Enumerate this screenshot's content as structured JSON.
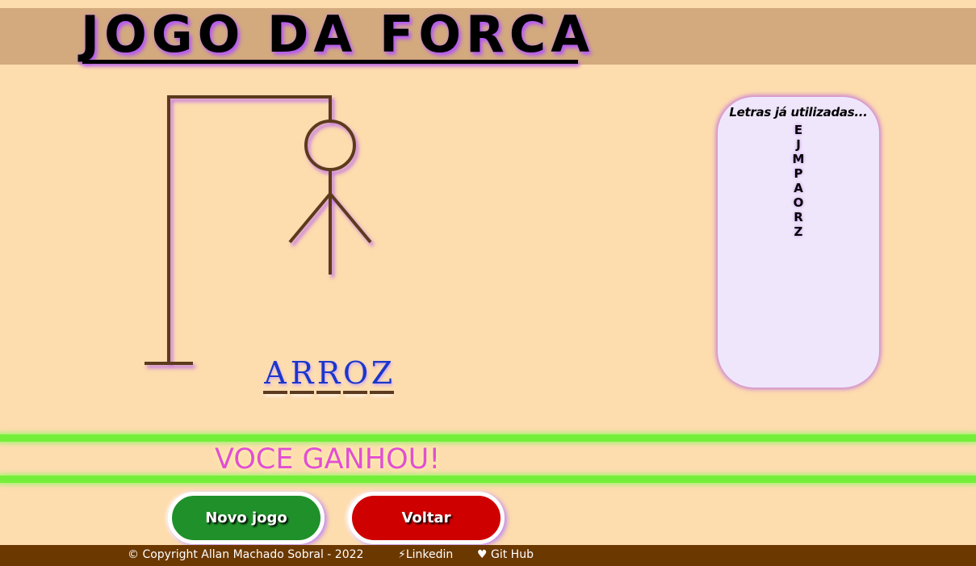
{
  "header": {
    "title": "JOGO DA FORCA"
  },
  "word": {
    "letters": [
      "A",
      "R",
      "R",
      "O",
      "Z"
    ]
  },
  "letters_panel": {
    "title": "Letras já utilizadas...",
    "used": [
      "E",
      "J",
      "M",
      "P",
      "A",
      "O",
      "R",
      "Z"
    ]
  },
  "result": {
    "message": "VOCE GANHOU!"
  },
  "buttons": {
    "new_game": "Novo jogo",
    "back": "Voltar"
  },
  "footer": {
    "copyright": "© Copyright Allan Machado Sobral - 2022",
    "linkedin": "⚡Linkedin",
    "github": "♥ Git Hub"
  },
  "colors": {
    "background": "#fddcae",
    "header_band": "#d2aa7d",
    "gallows": "#5c3a1e",
    "word_letters": "#1b37c9",
    "result_text": "#e24fd3",
    "new_game_button": "#20902a",
    "back_button": "#cf0000",
    "footer": "#6b3800",
    "green_line": "#74ef39"
  },
  "hangman": {
    "parts_drawn": [
      "head",
      "body",
      "left-arm",
      "right-arm"
    ]
  }
}
